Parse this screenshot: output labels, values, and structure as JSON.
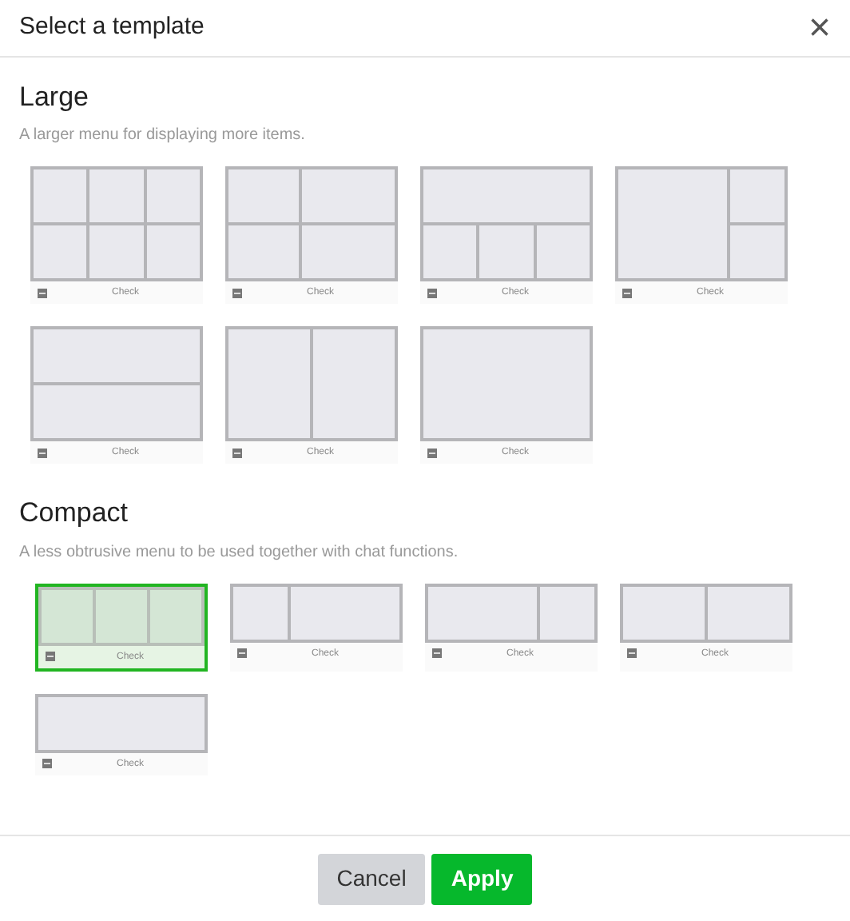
{
  "dialog": {
    "title": "Select a template",
    "close": "×"
  },
  "sections": [
    {
      "title": "Large",
      "description": "A larger menu for displaying more items.",
      "templates": [
        {
          "kind": "grid-3x2",
          "label": "Check",
          "selected": false
        },
        {
          "kind": "grid-2x2",
          "label": "Check",
          "selected": false
        },
        {
          "kind": "top-1-bottom-3",
          "label": "Check",
          "selected": false
        },
        {
          "kind": "big-left-2-right",
          "label": "Check",
          "selected": false
        },
        {
          "kind": "rows-2",
          "label": "Check",
          "selected": false
        },
        {
          "kind": "cols-2",
          "label": "Check",
          "selected": false
        },
        {
          "kind": "single",
          "label": "Check",
          "selected": false
        }
      ]
    },
    {
      "title": "Compact",
      "description": "A less obtrusive menu to be used together with chat functions.",
      "templates": [
        {
          "kind": "compact-cols-3",
          "label": "Check",
          "selected": true
        },
        {
          "kind": "compact-narrow-wide",
          "label": "Check",
          "selected": false
        },
        {
          "kind": "compact-wide-narrow",
          "label": "Check",
          "selected": false
        },
        {
          "kind": "compact-cols-2",
          "label": "Check",
          "selected": false
        },
        {
          "kind": "compact-single",
          "label": "Check",
          "selected": false
        }
      ]
    }
  ],
  "buttons": [
    {
      "kind": "secondary",
      "label": "Cancel"
    },
    {
      "kind": "primary",
      "label": "Apply"
    }
  ]
}
